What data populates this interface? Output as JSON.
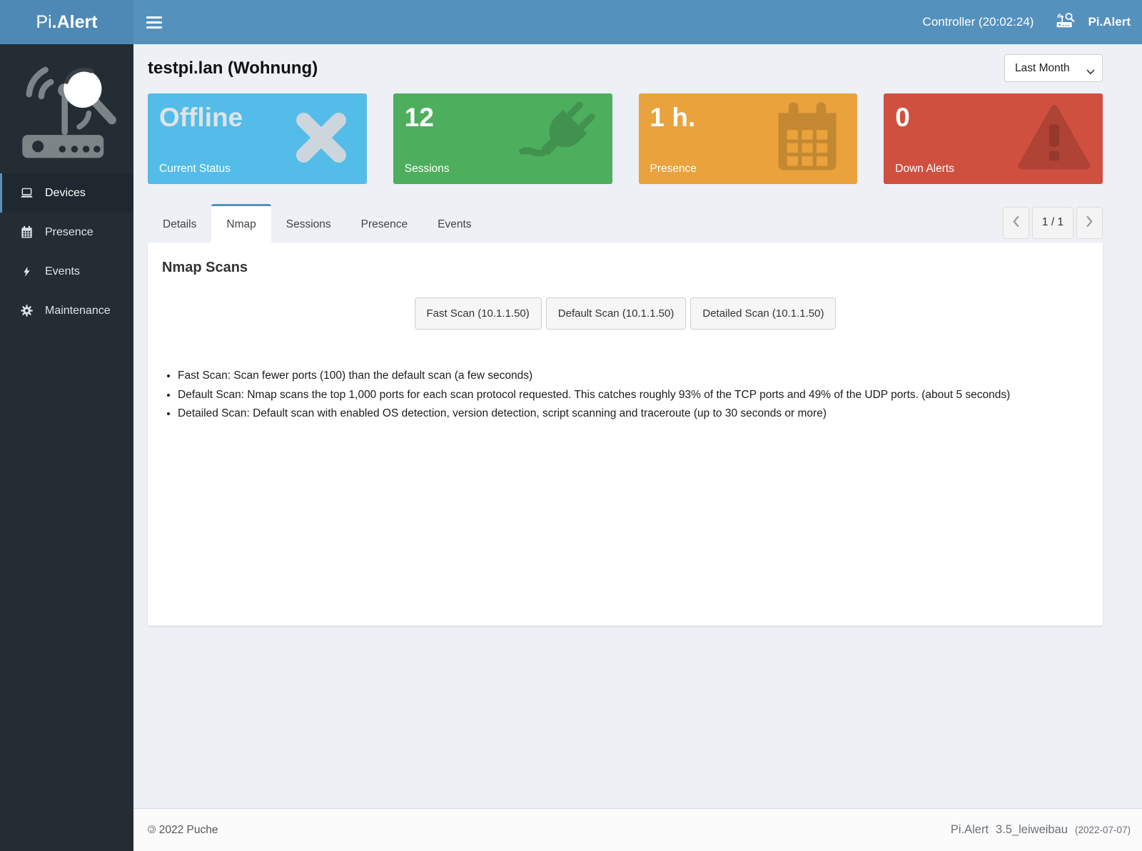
{
  "header": {
    "brand_prefix": "Pi",
    "brand_suffix": ".Alert",
    "menu_icon": "hamburger-icon",
    "controller_label": "Controller (20:02:24)",
    "account_icon": "router-scan-icon",
    "account_label": "Pi.Alert"
  },
  "sidebar": {
    "logo_icon": "pialert-router-magnifier-logo",
    "items": [
      {
        "label": "Devices",
        "icon": "laptop-icon",
        "active": true
      },
      {
        "label": "Presence",
        "icon": "calendar-icon",
        "active": false
      },
      {
        "label": "Events",
        "icon": "bolt-icon",
        "active": false
      },
      {
        "label": "Maintenance",
        "icon": "gear-icon",
        "active": false
      }
    ]
  },
  "main": {
    "title": "testpi.lan (Wohnung)",
    "period_select": {
      "value": "Last Month",
      "chevron_icon": "chevron-down-icon"
    },
    "cards": [
      {
        "value": "Offline",
        "label": "Current Status",
        "color": "#54bce8",
        "icon": "x-mark-icon"
      },
      {
        "value": "12",
        "label": "Sessions",
        "color": "#4dae5e",
        "icon": "plug-icon"
      },
      {
        "value": "1 h.",
        "label": "Presence",
        "color": "#e9a23c",
        "icon": "calendar-icon"
      },
      {
        "value": "0",
        "label": "Down Alerts",
        "color": "#d0503f",
        "icon": "warning-triangle-icon"
      }
    ],
    "tabs": [
      {
        "label": "Details",
        "active": false
      },
      {
        "label": "Nmap",
        "active": true
      },
      {
        "label": "Sessions",
        "active": false
      },
      {
        "label": "Presence",
        "active": false
      },
      {
        "label": "Events",
        "active": false
      }
    ],
    "pagination": {
      "prev_icon": "chevron-left-icon",
      "label": "1 / 1",
      "next_icon": "chevron-right-icon"
    },
    "nmap": {
      "heading": "Nmap Scans",
      "scan_buttons": [
        {
          "label": "Fast Scan (10.1.1.50)"
        },
        {
          "label": "Default Scan (10.1.1.50)"
        },
        {
          "label": "Detailed Scan (10.1.1.50)"
        }
      ],
      "notes": [
        "Fast Scan: Scan fewer ports (100) than the default scan (a few seconds)",
        "Default Scan: Nmap scans the top 1,000 ports for each scan protocol requested. This catches roughly 93% of the TCP ports and 49% of the UDP ports. (about 5 seconds)",
        "Detailed Scan: Default scan with enabled OS detection, version detection, script scanning and traceroute (up to 30 seconds or more)"
      ]
    }
  },
  "footer": {
    "copyright_symbol": "©",
    "copyright_text": "2022 Puche",
    "app_name": "Pi.Alert",
    "version": "3.5_leiweibau",
    "release_date": "(2022-07-07)"
  },
  "colors": {
    "header_blue": "#5591bd",
    "brand_blue": "#4e89b6",
    "sidebar_dark": "#242d33",
    "page_background": "#edf0f5",
    "card_blue": "#54bce8",
    "card_green": "#4dae5e",
    "card_orange": "#e9a23c",
    "card_red": "#d0503f",
    "active_tab_accent": "#5591bd"
  }
}
